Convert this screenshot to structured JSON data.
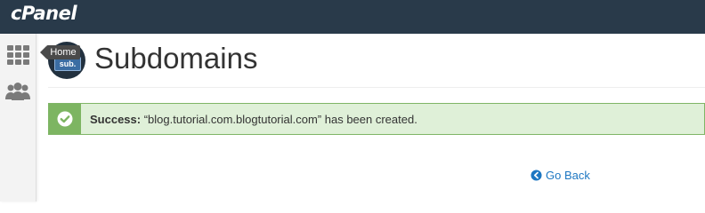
{
  "header": {
    "logo_text": "cPanel",
    "background": "#293a4a"
  },
  "sidebar": {
    "items": [
      {
        "icon": "grid-icon",
        "label": "Home"
      },
      {
        "icon": "users-icon",
        "label": ""
      }
    ],
    "tooltip": "Home"
  },
  "page": {
    "icon_text": "sub.",
    "title": "Subdomains"
  },
  "alert": {
    "type": "success",
    "icon": "check-circle-icon",
    "prefix": "Success:",
    "message": "“blog.tutorial.com.blogtutorial.com” has been created.",
    "colors": {
      "background": "#dff0d8",
      "border": "#7fb566",
      "icon_bg": "#7db562"
    }
  },
  "actions": {
    "go_back_label": "Go Back",
    "go_back_icon": "arrow-left-circle-icon",
    "link_color": "#1d77c2"
  }
}
